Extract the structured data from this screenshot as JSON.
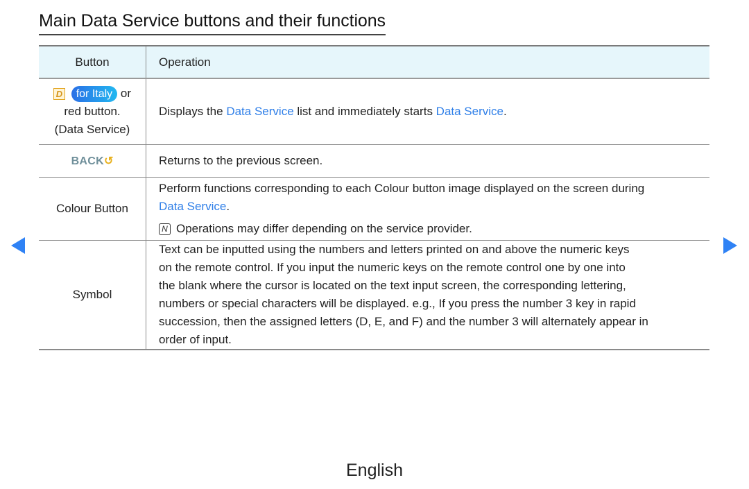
{
  "page": {
    "title": "Main Data Service buttons and their functions",
    "language": "English"
  },
  "navigation": {
    "prev_icon": "left-triangle-arrow",
    "next_icon": "right-triangle-arrow"
  },
  "colors": {
    "highlight": "#2f7fe8",
    "header_bg": "#e6f6fb",
    "nav_arrow": "#2f82f5",
    "back_label": "#6f8f9a",
    "back_icon": "#e8b01c"
  },
  "table": {
    "headers": {
      "button": "Button",
      "operation": "Operation"
    },
    "rows": [
      {
        "button": {
          "d_icon_glyph": "D",
          "pill": "for Italy",
          "suffix": "or",
          "line2": "red button.",
          "line3": "(Data Service)"
        },
        "operation": {
          "part1": "Displays the ",
          "hl1": "Data Service",
          "part2": " list and immediately starts ",
          "hl2": "Data Service",
          "part3": "."
        }
      },
      {
        "button": {
          "label": "BACK",
          "icon_glyph": "↺"
        },
        "operation": {
          "text": "Returns to the previous screen."
        }
      },
      {
        "button": {
          "label": "Colour Button"
        },
        "operation": {
          "line1": "Perform functions corresponding to each Colour button image displayed on the screen during",
          "hl": "Data Service",
          "hl_suffix": ".",
          "note_icon_glyph": "N",
          "note": "Operations may differ depending on the service provider."
        }
      },
      {
        "button": {
          "label": "Symbol"
        },
        "operation": {
          "lines": [
            "Text can be inputted using the numbers and letters printed on and above the numeric keys",
            "on the remote control. If you input the numeric keys on the remote control one by one into",
            "the blank where the cursor is located on the text input screen, the corresponding lettering,",
            "numbers or special characters will be displayed. e.g., If you press the number 3 key in rapid",
            "succession, then the assigned letters (D, E, and F) and the number 3 will alternately appear in",
            "order of input."
          ]
        }
      }
    ]
  }
}
